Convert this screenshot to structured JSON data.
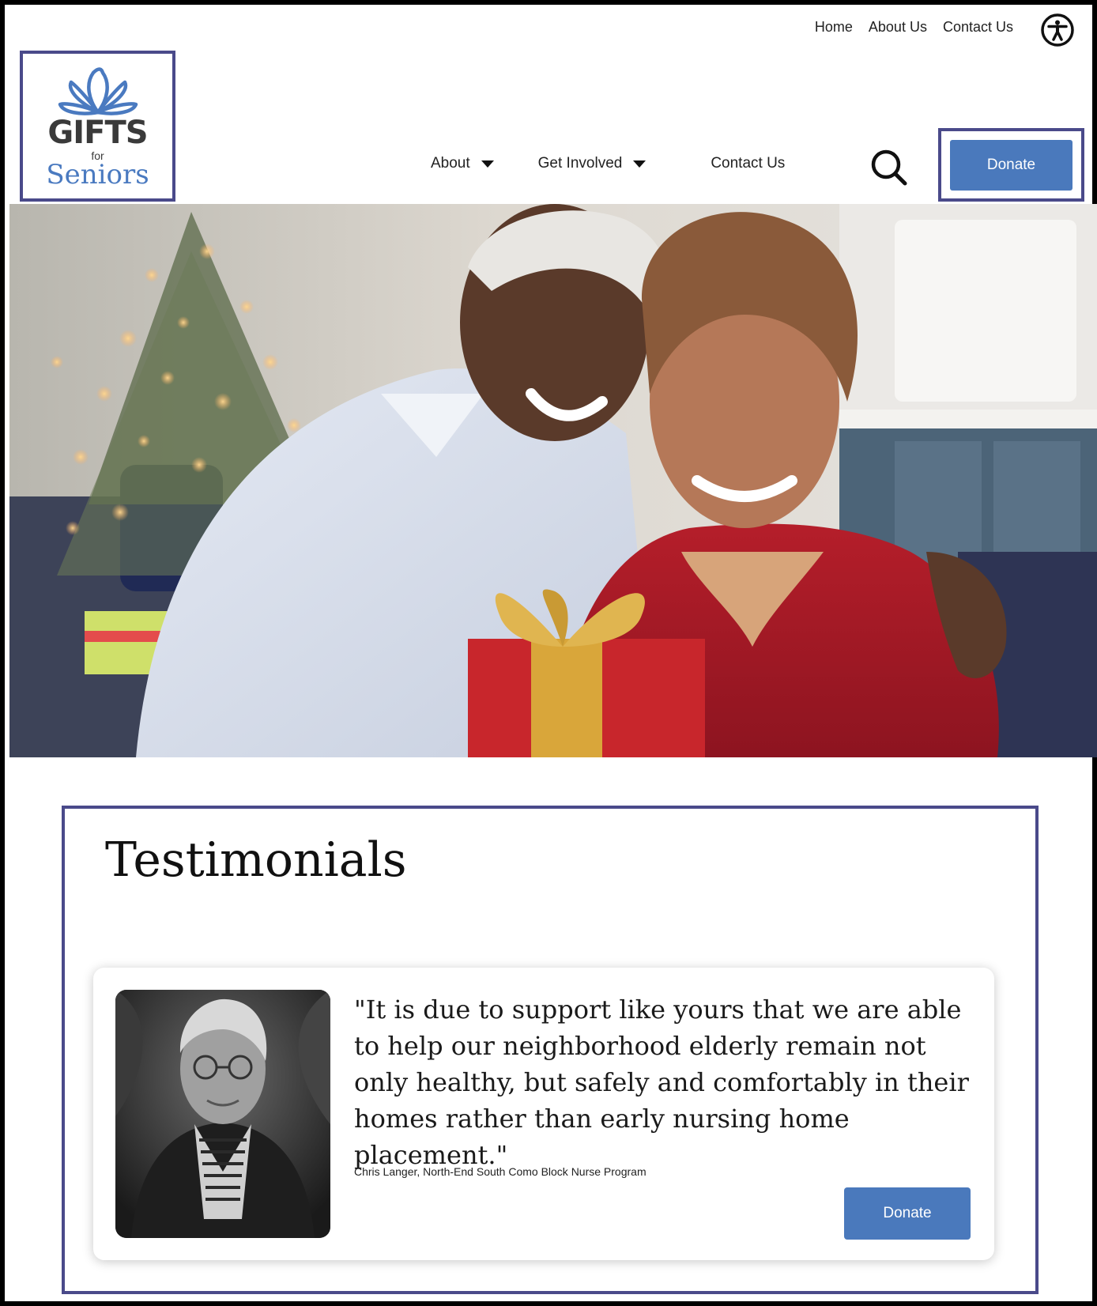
{
  "utility_nav": {
    "links": [
      "Home",
      "About Us",
      "Contact Us"
    ],
    "accessibility_icon": "accessibility-icon"
  },
  "logo": {
    "line1": "GIFTS",
    "line2": "for",
    "line3": "Seniors",
    "icon": "bow-icon",
    "colors": {
      "dark": "#3a3a3a",
      "blue": "#4a7ac0"
    }
  },
  "main_nav": {
    "items": [
      {
        "label": "About",
        "has_dropdown": true
      },
      {
        "label": "Get Involved",
        "has_dropdown": true
      },
      {
        "label": "Contact Us",
        "has_dropdown": false
      }
    ],
    "search_icon": "search-icon",
    "donate_label": "Donate"
  },
  "hero": {
    "image": "hero-photo"
  },
  "testimonials": {
    "title": "Testimonials",
    "quote": "\"It is due to support like yours that we are able to help our neighborhood elderly remain not only healthy, but safely and comfortably in their homes rather than early nursing home placement.\"",
    "author": "Chris Langer, North-End South Como Block Nurse Program",
    "donate_label": "Donate"
  },
  "colors": {
    "accent": "#4a79bc",
    "outline": "#4a4a8a",
    "frame": "#000000"
  }
}
